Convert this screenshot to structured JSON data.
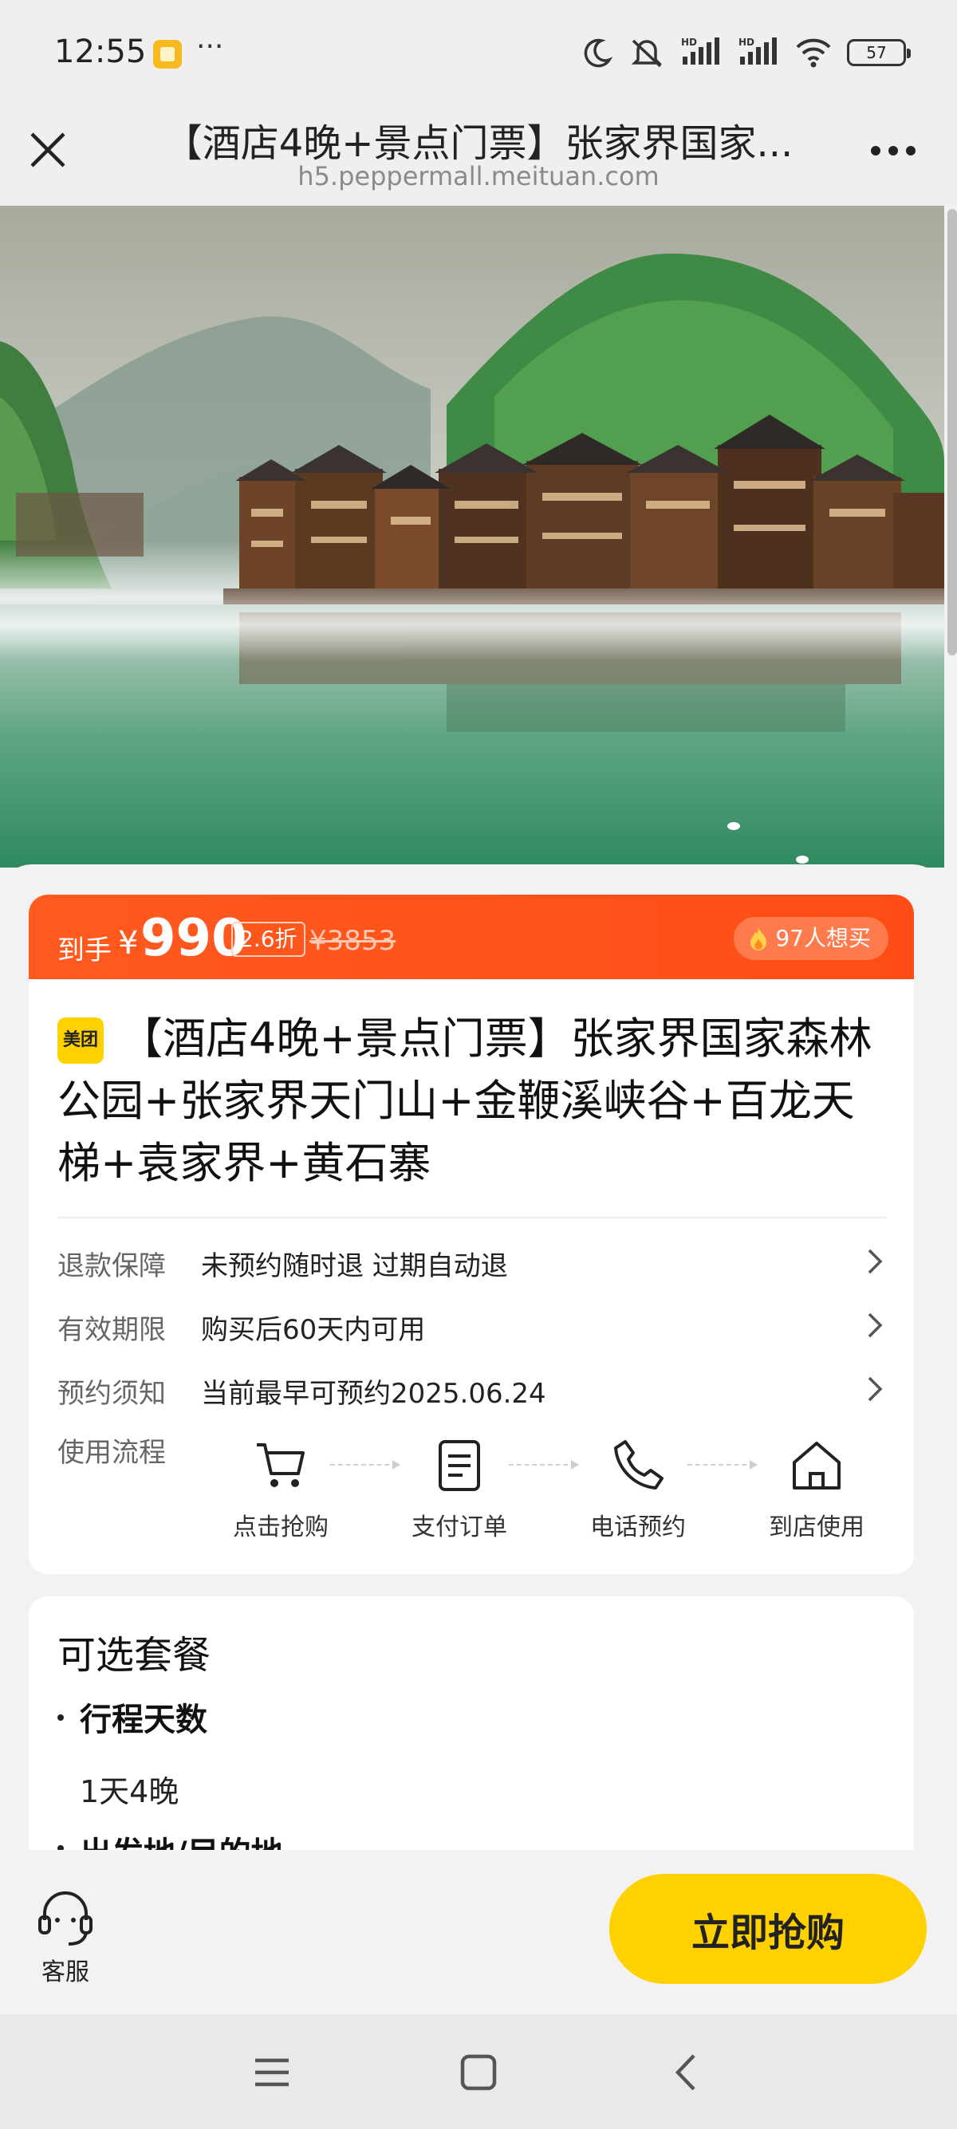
{
  "status_bar": {
    "time": "12:55",
    "more": "···",
    "battery": "57",
    "icons": [
      "moon-icon",
      "mute-icon",
      "hd-signal-icon",
      "hd-signal-icon",
      "wifi-icon",
      "battery-icon"
    ]
  },
  "nav": {
    "title": "【酒店4晚+景点门票】张家界国家...",
    "subtitle": "h5.peppermall.meituan.com"
  },
  "price": {
    "prefix": "到手",
    "yen": "¥",
    "value": "990",
    "discount": "2.6折",
    "original": "¥3853",
    "want_count": "97人想买"
  },
  "product": {
    "brand": "美团",
    "title": "【酒店4晚+景点门票】张家界国家森林公园+张家界天门山+金鞭溪峡谷+百龙天梯+袁家界+黄石寨"
  },
  "info_rows": [
    {
      "label": "退款保障",
      "value": "未预约随时退 过期自动退"
    },
    {
      "label": "有效期限",
      "value": "购买后60天内可用"
    },
    {
      "label": "预约须知",
      "value": "当前最早可预约2025.06.24"
    }
  ],
  "flow": {
    "label": "使用流程",
    "steps": [
      {
        "label": "点击抢购",
        "icon": "cart-icon"
      },
      {
        "label": "支付订单",
        "icon": "order-icon"
      },
      {
        "label": "电话预约",
        "icon": "phone-icon"
      },
      {
        "label": "到店使用",
        "icon": "home-icon"
      }
    ]
  },
  "package": {
    "title": "可选套餐",
    "section_1": "行程天数",
    "option_1": "1天4晚",
    "section_2": "出发地/目的地"
  },
  "bottom": {
    "service_label": "客服",
    "buy_label": "立即抢购"
  },
  "colors": {
    "accent_orange": "#ff5a1f",
    "buy_yellow": "#ffd100"
  }
}
